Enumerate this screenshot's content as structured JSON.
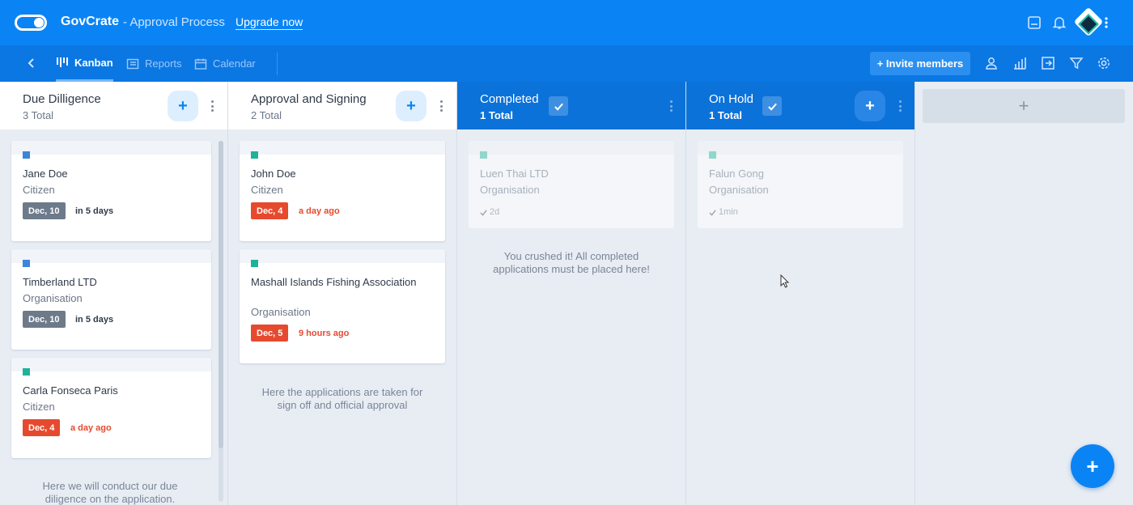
{
  "header": {
    "app_name": "GovCrate",
    "app_sub": "- Approval Process",
    "upgrade_label": "Upgrade now",
    "icons": [
      "inbox-icon",
      "bell-icon",
      "avatar",
      "more-vert-icon"
    ]
  },
  "subnav": {
    "tabs": [
      {
        "label": "Kanban",
        "active": true
      },
      {
        "label": "Reports",
        "active": false
      },
      {
        "label": "Calendar",
        "active": false
      }
    ],
    "invite_label": "+ Invite members",
    "icons": [
      "user-icon",
      "bar-chart-icon",
      "export-icon",
      "filter-icon",
      "settings-icon"
    ]
  },
  "colors": {
    "primary": "#0a84f5",
    "subbar": "#0b77e3",
    "overdue": "#e64a2e",
    "neutral_badge": "#6d7a8a",
    "dot_blue": "#3b86d9",
    "dot_teal": "#1fb29a"
  },
  "columns": [
    {
      "title": "Due Dilligence",
      "count": "3 Total",
      "note": "Here we will conduct our due diligence on the application.",
      "cards": [
        {
          "name": "Jane Doe",
          "type": "Citizen",
          "date": "Dec, 10",
          "due": "in 5 days"
        },
        {
          "name": "Timberland LTD",
          "type": "Organisation",
          "date": "Dec, 10",
          "due": "in 5 days"
        },
        {
          "name": "Carla Fonseca Paris",
          "type": "Citizen",
          "date": "Dec, 4",
          "due": "a day ago"
        }
      ]
    },
    {
      "title": "Approval and Signing",
      "count": "2 Total",
      "note": "Here the applications are taken for sign off and official approval",
      "cards": [
        {
          "name": "John Doe",
          "type": "Citizen",
          "date": "Dec, 4",
          "due": "a day ago"
        },
        {
          "name": "Mashall Islands Fishing Association",
          "type": "Organisation",
          "date": "Dec, 5",
          "due": "9 hours ago"
        }
      ]
    },
    {
      "title": "Completed",
      "count": "1 Total",
      "note": "You crushed it! All completed applications must be placed here!",
      "cards": [
        {
          "name": "Luen Thai LTD",
          "type": "Organisation",
          "done": "2d"
        }
      ]
    },
    {
      "title": "On Hold",
      "count": "1 Total",
      "cards": [
        {
          "name": "Falun Gong",
          "type": "Organisation",
          "done": "1min"
        }
      ]
    }
  ],
  "add_column_label": "+",
  "fab_label": "+"
}
